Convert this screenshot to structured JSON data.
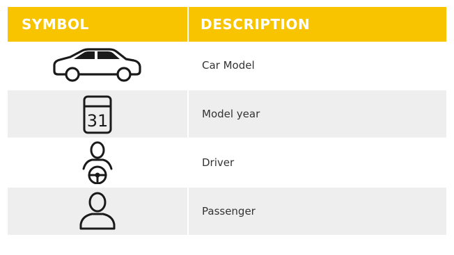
{
  "header": {
    "symbol_label": "SYMBOL",
    "description_label": "DESCRIPTION"
  },
  "rows": [
    {
      "icon": "car-icon",
      "description": "Car Model"
    },
    {
      "icon": "calendar-icon",
      "icon_text": "31",
      "description": "Model year"
    },
    {
      "icon": "driver-icon",
      "description": "Driver"
    },
    {
      "icon": "passenger-icon",
      "description": "Passenger"
    }
  ],
  "colors": {
    "header_background": "#f8c400",
    "header_text": "#ffffff",
    "row_shade": "#eeeeee",
    "icon_stroke": "#1a1a1a"
  }
}
